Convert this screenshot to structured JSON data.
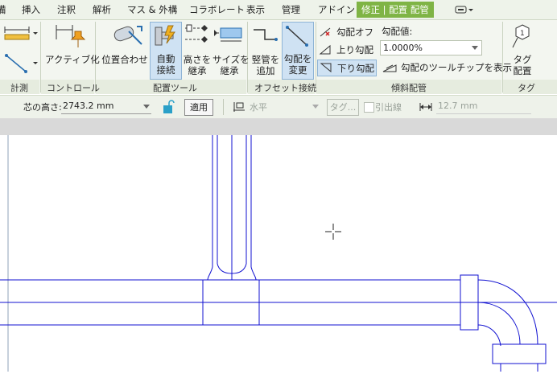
{
  "tabs": {
    "t0": "備",
    "t1": "挿入",
    "t2": "注釈",
    "t3": "解析",
    "t4": "マス & 外構",
    "t5": "コラボレート",
    "t6": "表示",
    "t7": "管理",
    "t8": "アドイン",
    "active": "修正 | 配置 配管"
  },
  "ribbon": {
    "measure": {
      "title": "計測"
    },
    "control": {
      "activate": "アクティブ化",
      "title": "コントロール"
    },
    "placement": {
      "align": "位置合わせ",
      "auto_connect_1": "自動",
      "auto_connect_2": "接続",
      "inherit_height_1": "高さを",
      "inherit_height_2": "継承",
      "inherit_size_1": "サイズを",
      "inherit_size_2": "継承",
      "title": "配置ツール"
    },
    "offset": {
      "add_riser_1": "竪管を",
      "add_riser_2": "追加",
      "change_slope_1": "勾配を",
      "change_slope_2": "変更",
      "title": "オフセット接続"
    },
    "slope": {
      "off": "勾配オフ",
      "up": "上り勾配",
      "down": "下り勾配",
      "value_label": "勾配値:",
      "value": "1.0000%",
      "tooltip": "勾配のツールチップを表示",
      "title": "傾斜配管"
    },
    "tag": {
      "label_1": "タグ",
      "label_2": "配置",
      "title": "タグ",
      "badge": "1"
    }
  },
  "options": {
    "center_height_label": "芯の高さ:",
    "center_height_value": "2743.2 mm",
    "apply": "適用",
    "justification": "水平",
    "tag": "タグ...",
    "leader": "引出線",
    "leader_length": "12.7 mm"
  },
  "colors": {
    "pipe": "#1010d0",
    "accent": "#7fb445"
  }
}
